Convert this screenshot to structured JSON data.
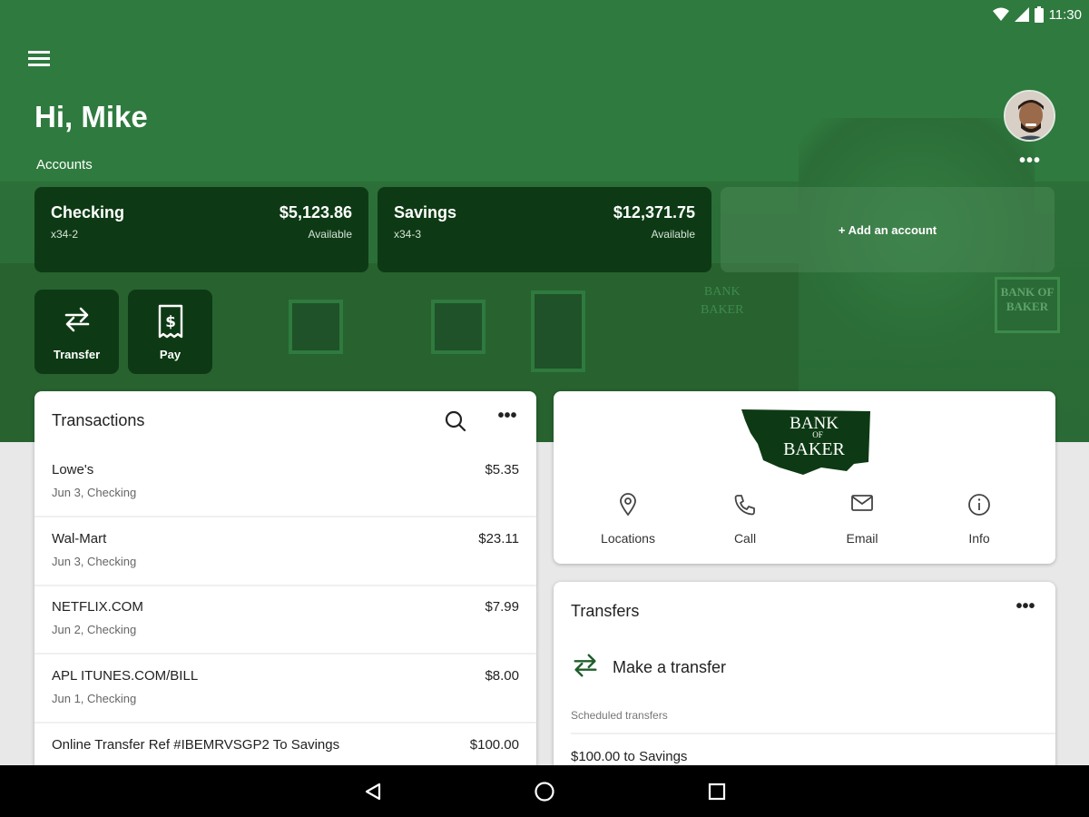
{
  "status_bar": {
    "time": "11:30"
  },
  "header": {
    "greeting": "Hi, Mike",
    "accounts_label": "Accounts"
  },
  "accounts": [
    {
      "name": "Checking",
      "number": "x34-2",
      "balance": "$5,123.86",
      "balance_label": "Available"
    },
    {
      "name": "Savings",
      "number": "x34-3",
      "balance": "$12,371.75",
      "balance_label": "Available"
    }
  ],
  "add_account_label": "+ Add an account",
  "quick_actions": [
    {
      "label": "Transfer",
      "icon": "transfer-icon"
    },
    {
      "label": "Pay",
      "icon": "bill-icon"
    }
  ],
  "transactions": {
    "title": "Transactions",
    "items": [
      {
        "merchant": "Lowe's",
        "sub": "Jun 3, Checking",
        "amount": "$5.35"
      },
      {
        "merchant": "Wal-Mart",
        "sub": "Jun 3, Checking",
        "amount": "$23.11"
      },
      {
        "merchant": "NETFLIX.COM",
        "sub": "Jun 2, Checking",
        "amount": "$7.99"
      },
      {
        "merchant": "APL ITUNES.COM/BILL",
        "sub": "Jun 1, Checking",
        "amount": "$8.00"
      },
      {
        "merchant": "Online Transfer Ref #IBEMRVSGP2 To Savings",
        "sub": "",
        "amount": "$100.00"
      }
    ]
  },
  "bank": {
    "logo_text_top": "BANK",
    "logo_text_mid": "OF",
    "logo_text_bottom": "BAKER",
    "sign_text": "BANK OF BAKER",
    "building_text_1": "BANK",
    "building_text_2": "BAKER",
    "contacts": [
      {
        "label": "Locations",
        "icon": "location-pin-icon"
      },
      {
        "label": "Call",
        "icon": "phone-icon"
      },
      {
        "label": "Email",
        "icon": "email-icon"
      },
      {
        "label": "Info",
        "icon": "info-icon"
      }
    ]
  },
  "transfers": {
    "title": "Transfers",
    "make_transfer": "Make a transfer",
    "scheduled_label": "Scheduled transfers",
    "scheduled_items": [
      "$100.00 to Savings"
    ]
  },
  "colors": {
    "brand_green": "#2f7a3e",
    "dark_green": "#0d3a14"
  }
}
